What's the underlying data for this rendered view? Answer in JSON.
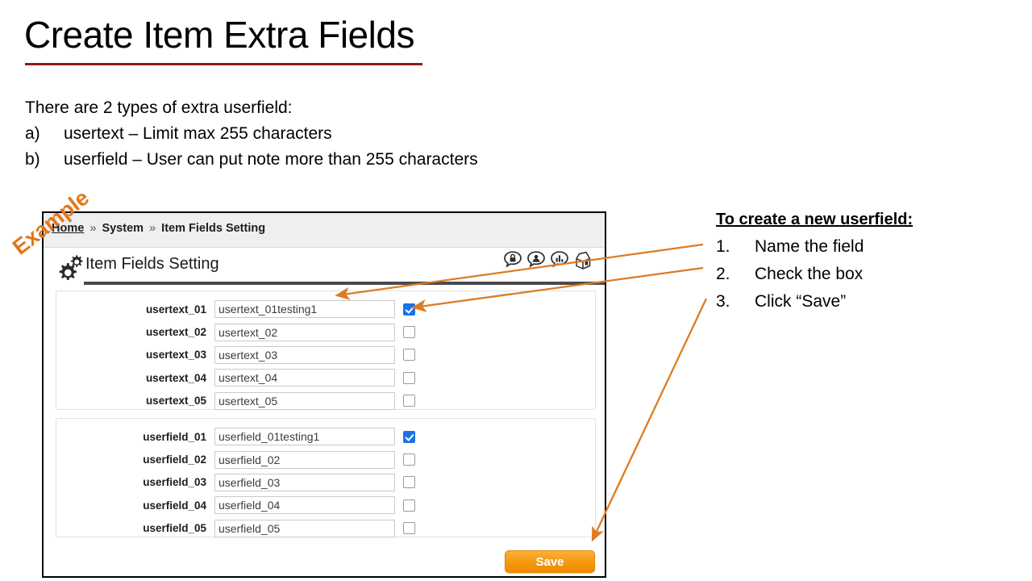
{
  "slide": {
    "title": "Create Item Extra Fields",
    "intro_line": "There are 2 types of extra userfield:",
    "intro_items": [
      {
        "marker": "a)",
        "text": "usertext – Limit max 255 characters"
      },
      {
        "marker": "b)",
        "text": "userfield – User can put note more than 255 characters"
      }
    ],
    "watermark": "Example",
    "accent_color": "#E2761B",
    "title_rule_color": "#8C1A1A"
  },
  "screenshot": {
    "breadcrumb": {
      "home": "Home",
      "separator": "»",
      "section": "System",
      "page": "Item Fields Setting"
    },
    "page_heading": "Item Fields Setting",
    "header_icons": [
      "lock-bubble-icon",
      "user-bubble-icon",
      "chart-bubble-icon",
      "package-box-icon"
    ],
    "groups": [
      {
        "id": "usertext",
        "rows": [
          {
            "label": "usertext_01",
            "value": "usertext_01testing1",
            "checked": true
          },
          {
            "label": "usertext_02",
            "value": "usertext_02",
            "checked": false
          },
          {
            "label": "usertext_03",
            "value": "usertext_03",
            "checked": false
          },
          {
            "label": "usertext_04",
            "value": "usertext_04",
            "checked": false
          },
          {
            "label": "usertext_05",
            "value": "usertext_05",
            "checked": false
          }
        ]
      },
      {
        "id": "userfield",
        "rows": [
          {
            "label": "userfield_01",
            "value": "userfield_01testing1",
            "checked": true
          },
          {
            "label": "userfield_02",
            "value": "userfield_02",
            "checked": false
          },
          {
            "label": "userfield_03",
            "value": "userfield_03",
            "checked": false
          },
          {
            "label": "userfield_04",
            "value": "userfield_04",
            "checked": false
          },
          {
            "label": "userfield_05",
            "value": "userfield_05",
            "checked": false
          }
        ]
      }
    ],
    "save_label": "Save",
    "save_color": "#F59B10"
  },
  "instructions": {
    "title": "To create a new userfield:",
    "steps": [
      {
        "marker": "1.",
        "text": "Name the field"
      },
      {
        "marker": "2.",
        "text": "Check the box"
      },
      {
        "marker": "3.",
        "text": "Click “Save”"
      }
    ]
  }
}
